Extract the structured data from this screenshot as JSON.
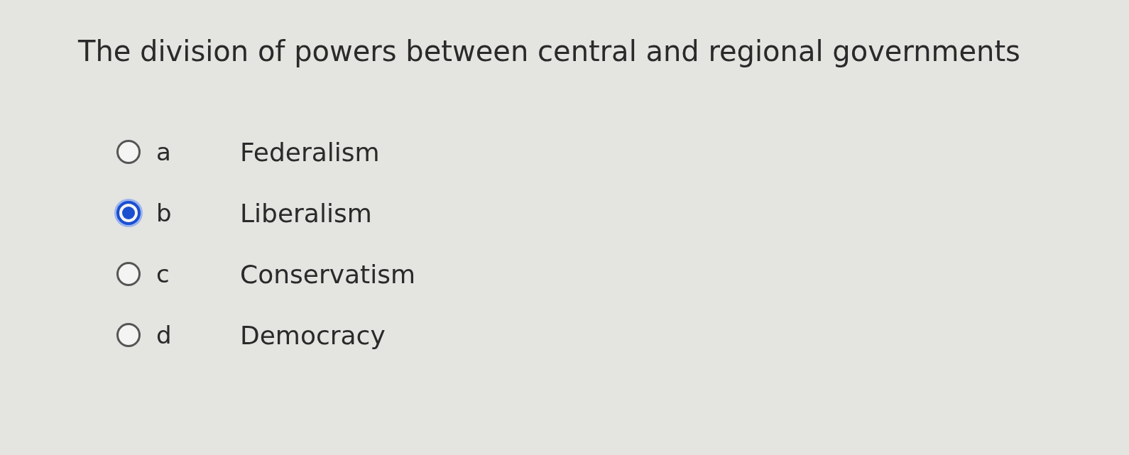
{
  "question": "The division of powers between central and regional governments",
  "options": [
    {
      "letter": "a",
      "text": "Federalism",
      "selected": false
    },
    {
      "letter": "b",
      "text": "Liberalism",
      "selected": true
    },
    {
      "letter": "c",
      "text": "Conservatism",
      "selected": false
    },
    {
      "letter": "d",
      "text": "Democracy",
      "selected": false
    }
  ]
}
